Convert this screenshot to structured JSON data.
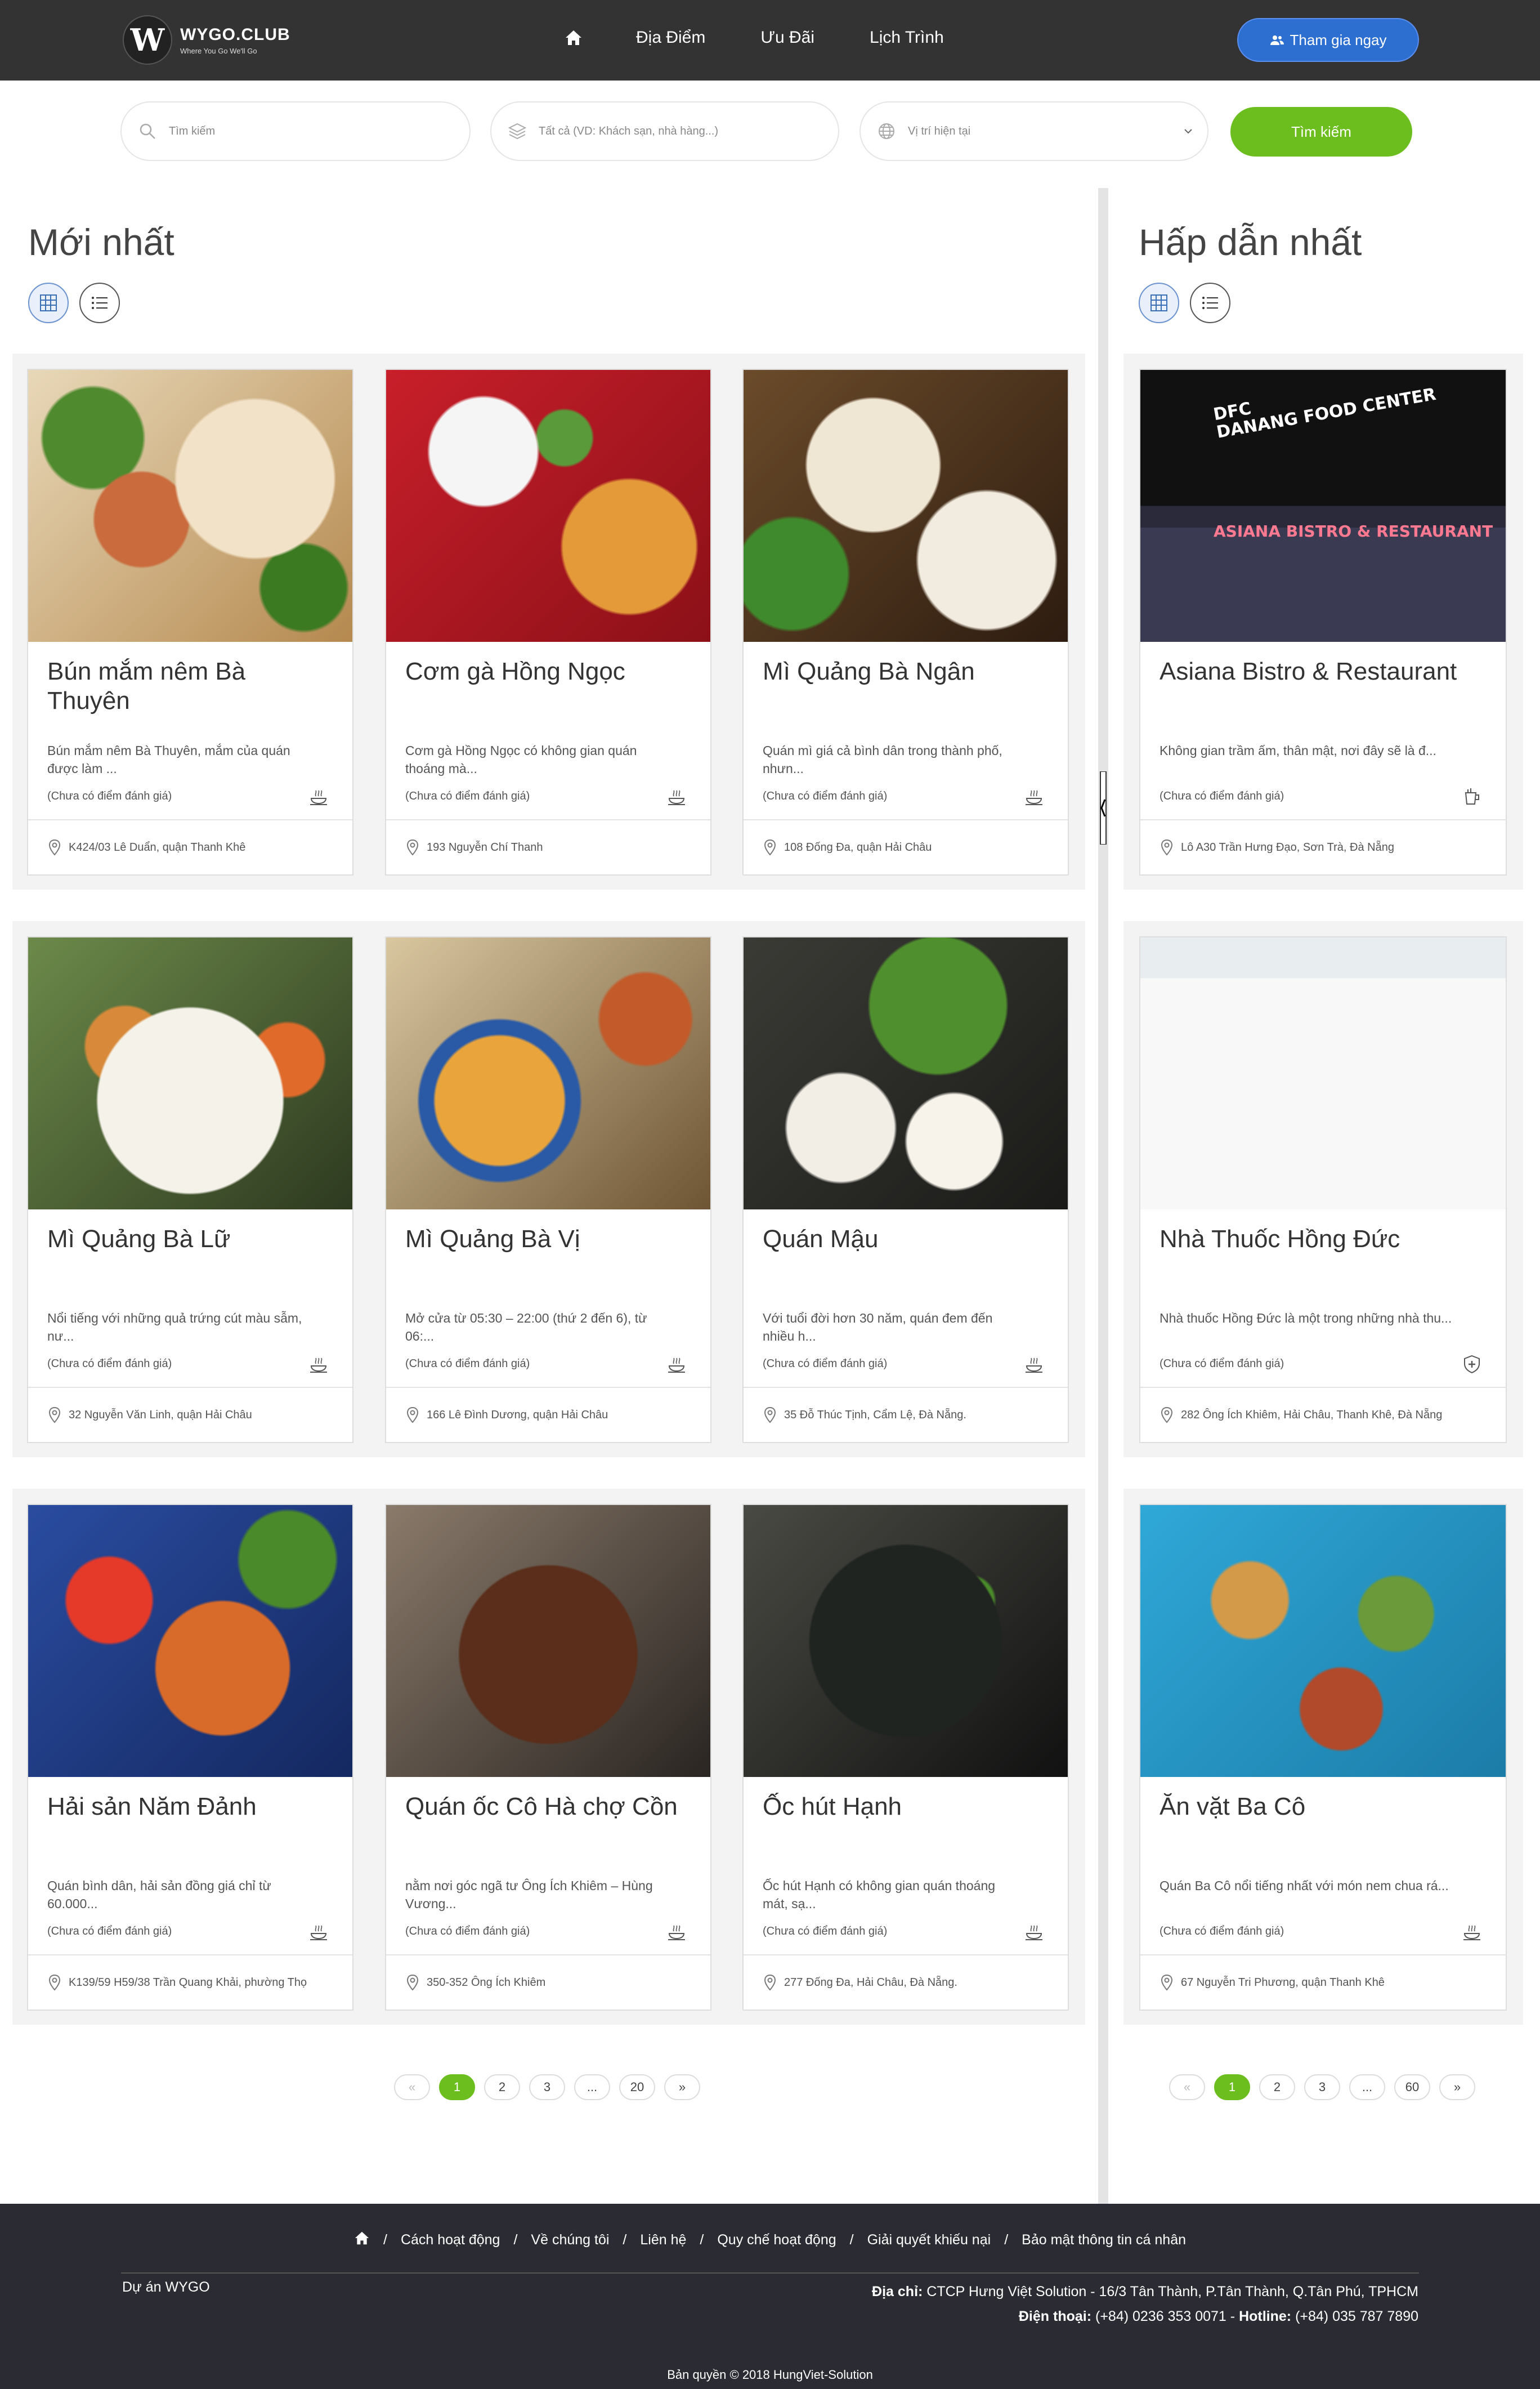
{
  "header": {
    "logo_letter": "W",
    "logo_name": "WYGO.CLUB",
    "logo_tagline": "Where You Go We'll Go",
    "nav": [
      "Địa Điểm",
      "Ưu Đãi",
      "Lịch Trình"
    ],
    "join_label": "Tham gia ngay"
  },
  "search": {
    "keyword_placeholder": "Tìm kiếm",
    "category_placeholder": "Tất cả (VD: Khách sạn, nhà hàng...)",
    "location_placeholder": "Vị trí hiện tại",
    "button_label": "Tìm kiếm"
  },
  "newest": {
    "title": "Mới nhất",
    "cards": [
      {
        "title": "Bún mắm nêm Bà Thuyên",
        "desc": "Bún mắm nêm Bà Thuyên, mắm của quán được làm ...",
        "rating": "(Chưa có điểm đánh giá)",
        "address": "K424/03 Lê Duẩn, quận Thanh Khê",
        "icon": "food-icon"
      },
      {
        "title": "Cơm gà Hồng Ngọc",
        "desc": "Cơm gà Hồng Ngọc có không gian quán thoáng mà...",
        "rating": "(Chưa có điểm đánh giá)",
        "address": "193 Nguyễn Chí Thanh",
        "icon": "food-icon"
      },
      {
        "title": "Mì Quảng Bà Ngân",
        "desc": "Quán mì giá cả bình dân trong thành phố, nhưn...",
        "rating": "(Chưa có điểm đánh giá)",
        "address": "108 Đống Đa, quận Hải Châu",
        "icon": "food-icon"
      },
      {
        "title": "Mì Quảng Bà Lữ",
        "desc": "Nổi tiếng với những quả trứng cút màu sẫm, nư...",
        "rating": "(Chưa có điểm đánh giá)",
        "address": "32 Nguyễn Văn Linh, quận Hải Châu",
        "icon": "food-icon"
      },
      {
        "title": "Mì Quảng Bà Vị",
        "desc": "Mở cửa từ 05:30 – 22:00 (thứ 2 đến 6), từ 06:...",
        "rating": "(Chưa có điểm đánh giá)",
        "address": "166 Lê Đình Dương, quận Hải Châu",
        "icon": "food-icon"
      },
      {
        "title": "Quán Mậu",
        "desc": "Với tuổi đời hơn 30 năm, quán đem đến nhiều h...",
        "rating": "(Chưa có điểm đánh giá)",
        "address": "35 Đỗ Thúc Tịnh, Cẩm Lệ, Đà Nẵng.",
        "icon": "food-icon"
      },
      {
        "title": "Hải sản Năm Đảnh",
        "desc": "Quán bình dân, hải sản đồng giá chỉ từ 60.000...",
        "rating": "(Chưa có điểm đánh giá)",
        "address": "K139/59 H59/38 Trần Quang Khải, phường Thọ",
        "icon": "food-icon"
      },
      {
        "title": "Quán ốc Cô Hà chợ Cồn",
        "desc": "nằm nơi góc ngã tư Ông Ích Khiêm – Hùng Vương...",
        "rating": "(Chưa có điểm đánh giá)",
        "address": "350-352 Ông Ích Khiêm",
        "icon": "food-icon"
      },
      {
        "title": "Ốc hút Hạnh",
        "desc": "Ốc hút Hạnh có không gian quán thoáng mát, sạ...",
        "rating": "(Chưa có điểm đánh giá)",
        "address": "277 Đống Đa, Hải Châu, Đà Nẵng.",
        "icon": "food-icon"
      }
    ],
    "pagination": [
      "«",
      "1",
      "2",
      "3",
      "...",
      "20",
      "»"
    ]
  },
  "popular": {
    "title": "Hấp dẫn nhất",
    "cards": [
      {
        "title": "Asiana Bistro & Restaurant",
        "desc": "Không gian trầm ấm, thân mật, nơi đây sẽ là đ...",
        "rating": "(Chưa có điểm đánh giá)",
        "address": "Lô A30 Trần Hưng Đạo, Sơn Trà, Đà Nẵng",
        "icon": "drink-icon"
      },
      {
        "title": "Nhà Thuốc Hồng Đức",
        "desc": "Nhà thuốc Hồng Đức là một trong những nhà thu...",
        "rating": "(Chưa có điểm đánh giá)",
        "address": "282 Ông Ích Khiêm, Hải Châu, Thanh Khê, Đà Nẵng",
        "icon": "pharmacy-icon"
      },
      {
        "title": "Ăn vặt Ba Cô",
        "desc": "Quán Ba Cô nổi tiếng nhất với món nem chua rá...",
        "rating": "(Chưa có điểm đánh giá)",
        "address": "67 Nguyễn Tri Phương, quận Thanh Khê",
        "icon": "food-icon"
      }
    ],
    "photo_sign": "DFC\nDANANG FOOD CENTER",
    "photo_sign2": "ASIANA BISTRO & RESTAURANT",
    "pagination": [
      "«",
      "1",
      "2",
      "3",
      "...",
      "60",
      "»"
    ]
  },
  "footer": {
    "links": [
      "Cách hoạt động",
      "Về chúng tôi",
      "Liên hệ",
      "Quy chế hoạt động",
      "Giải quyết khiếu nại",
      "Bảo mật thông tin cá nhân"
    ],
    "project": "Dự án WYGO",
    "address_label": "Địa chỉ:",
    "address": "CTCP Hưng Việt Solution - 16/3 Tân Thành, P.Tân Thành, Q.Tân Phú, TPHCM",
    "phone_label": "Điện thoại:",
    "phone": "(+84) 0236 353 0071",
    "hotline_label": "Hotline:",
    "hotline": "(+84) 035 787 7890",
    "copyright": "Bản quyền © 2018 HungViet-Solution"
  }
}
